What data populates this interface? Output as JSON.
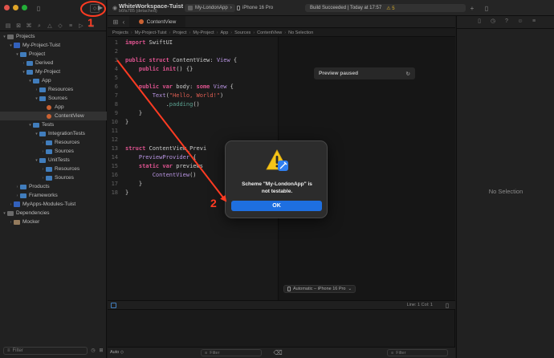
{
  "toolbar": {
    "workspace_title": "WhiteWorkspace-Tuist",
    "workspace_subtitle": "b6fa785 (detached)",
    "scheme": "My-LondonApp",
    "scheme_chevron": "›",
    "destination": "iPhone 16 Pro",
    "build_status": "Build Succeeded | Today at 17:57",
    "warning_count": "⚠ 5",
    "add_icon": "+"
  },
  "navigator": {
    "filter_placeholder": "Filter",
    "tree": [
      {
        "label": "Projects",
        "level": 0,
        "kind": "group",
        "disc": "▾"
      },
      {
        "label": "My-Project-Tuist",
        "level": 1,
        "kind": "proj",
        "disc": "▾"
      },
      {
        "label": "Project",
        "level": 2,
        "kind": "folder",
        "disc": "▾"
      },
      {
        "label": "Derived",
        "level": 3,
        "kind": "folder",
        "disc": "›"
      },
      {
        "label": "My-Project",
        "level": 3,
        "kind": "folder",
        "disc": "▾"
      },
      {
        "label": "App",
        "level": 4,
        "kind": "folder",
        "disc": "▾"
      },
      {
        "label": "Resources",
        "level": 5,
        "kind": "folder",
        "disc": "›"
      },
      {
        "label": "Sources",
        "level": 5,
        "kind": "folder",
        "disc": "▾"
      },
      {
        "label": "App",
        "level": 6,
        "kind": "swift",
        "disc": ""
      },
      {
        "label": "ContentView",
        "level": 6,
        "kind": "swift",
        "disc": "",
        "selected": true
      },
      {
        "label": "Tests",
        "level": 4,
        "kind": "folder",
        "disc": "▾"
      },
      {
        "label": "IntegrationTests",
        "level": 5,
        "kind": "folder",
        "disc": "▾"
      },
      {
        "label": "Resources",
        "level": 6,
        "kind": "folder",
        "disc": "›"
      },
      {
        "label": "Sources",
        "level": 6,
        "kind": "folder",
        "disc": "›"
      },
      {
        "label": "UnitTests",
        "level": 5,
        "kind": "folder",
        "disc": "▾"
      },
      {
        "label": "Resources",
        "level": 6,
        "kind": "folder",
        "disc": "›"
      },
      {
        "label": "Sources",
        "level": 6,
        "kind": "folder",
        "disc": "›"
      },
      {
        "label": "Products",
        "level": 2,
        "kind": "folder",
        "disc": "›"
      },
      {
        "label": "Frameworks",
        "level": 2,
        "kind": "folder",
        "disc": "›"
      },
      {
        "label": "MyApps-Modules-Tuist",
        "level": 1,
        "kind": "proj",
        "disc": "›"
      },
      {
        "label": "Dependencies",
        "level": 0,
        "kind": "group",
        "disc": "▾"
      },
      {
        "label": "Mocker",
        "level": 1,
        "kind": "pkg",
        "disc": "›"
      }
    ]
  },
  "editor": {
    "tab_label": "ContentView",
    "jump_bar": [
      "Projects",
      "My-Project-Tuist",
      "Project",
      "My-Project",
      "App",
      "Sources",
      "ContentView",
      "No Selection"
    ],
    "code_lines": [
      [
        [
          "kw",
          "import"
        ],
        [
          "pl",
          " SwiftUI"
        ]
      ],
      [],
      [
        [
          "kw",
          "public struct"
        ],
        [
          "pl",
          " ContentView: "
        ],
        [
          "ty",
          "View"
        ],
        [
          "pl",
          " {"
        ]
      ],
      [
        [
          "pl",
          "    "
        ],
        [
          "kw",
          "public init"
        ],
        [
          "pl",
          "() {}"
        ]
      ],
      [],
      [
        [
          "pl",
          "    "
        ],
        [
          "kw",
          "public var"
        ],
        [
          "pl",
          " body: "
        ],
        [
          "kw",
          "some"
        ],
        [
          "pl",
          " "
        ],
        [
          "ty",
          "View"
        ],
        [
          "pl",
          " {"
        ]
      ],
      [
        [
          "pl",
          "        "
        ],
        [
          "ty",
          "Text"
        ],
        [
          "pl",
          "("
        ],
        [
          "st",
          "\"Hello, World!\""
        ],
        [
          "pl",
          ")"
        ]
      ],
      [
        [
          "pl",
          "            ."
        ],
        [
          "fn",
          "padding"
        ],
        [
          "pl",
          "()"
        ]
      ],
      [
        [
          "pl",
          "    }"
        ]
      ],
      [
        [
          "pl",
          "}"
        ]
      ],
      [],
      [],
      [
        [
          "kw",
          "struct"
        ],
        [
          "pl",
          " ContentView_Previ"
        ]
      ],
      [
        [
          "pl",
          "    "
        ],
        [
          "ty",
          "PreviewProvider"
        ],
        [
          "pl",
          " {"
        ]
      ],
      [
        [
          "pl",
          "    "
        ],
        [
          "kw",
          "static var"
        ],
        [
          "pl",
          " previews"
        ]
      ],
      [
        [
          "pl",
          "        "
        ],
        [
          "ty",
          "ContentView"
        ],
        [
          "pl",
          "()"
        ]
      ],
      [
        [
          "pl",
          "    }"
        ]
      ],
      [
        [
          "pl",
          "}"
        ]
      ]
    ],
    "line_col": "Line: 1  Col: 1"
  },
  "canvas": {
    "preview_status": "Preview paused",
    "device": "Automatic – iPhone 16 Pro",
    "device_chevron": "⌄"
  },
  "inspector": {
    "empty_text": "No Selection"
  },
  "debug": {
    "auto_label": "Auto ◇",
    "filter_left": "Filter",
    "filter_right": "Filter"
  },
  "alert": {
    "message_line1": "Scheme \"My-LondonApp\" is",
    "message_line2": "not testable.",
    "ok_label": "OK"
  },
  "annotations": {
    "label_1": "1",
    "label_2": "2",
    "color": "#ff3b22"
  },
  "colors": {
    "accent": "#1e6fe0",
    "warning": "#f2c230",
    "swift": "#e8703a",
    "folder": "#4a8fd6"
  }
}
